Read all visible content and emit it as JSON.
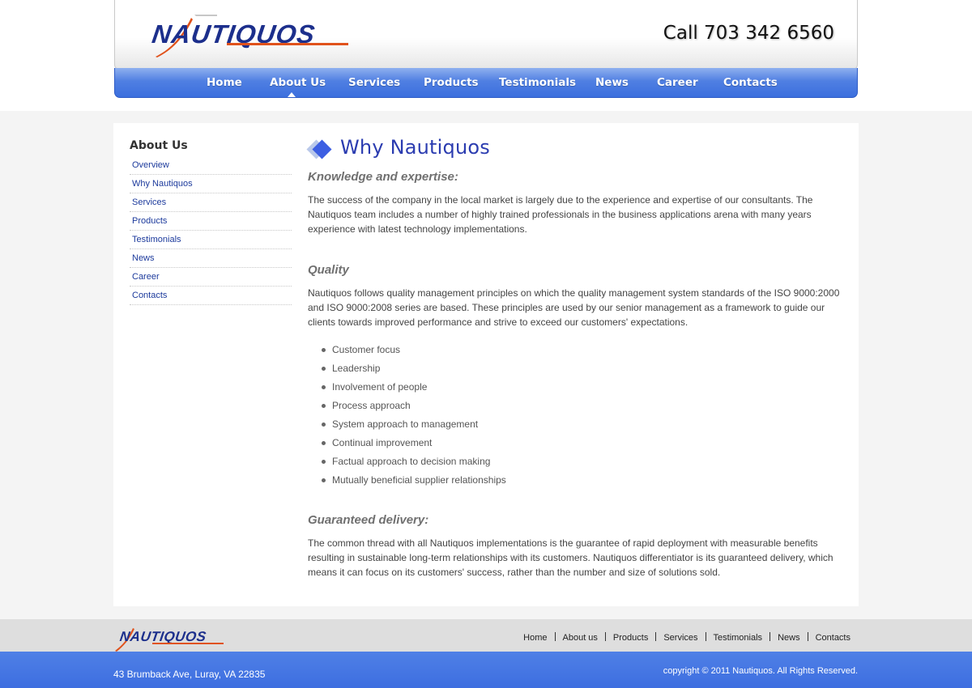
{
  "brand": {
    "logo_text": "NAUTIQUOS",
    "phone": "Call 703 342 6560",
    "colors": {
      "nav_blue": "#4f7fe2",
      "logo_blue": "#1c2f8c",
      "logo_orange": "#e0521b",
      "title_blue": "#2b3cb0"
    }
  },
  "nav": {
    "items": [
      "Home",
      "About Us",
      "Services",
      "Products",
      "Testimonials",
      "News",
      "Career",
      "Contacts"
    ],
    "active": "About Us"
  },
  "sidebar": {
    "title": "About Us",
    "items": [
      "Overview",
      "Why Nautiquos",
      "Services",
      "Products",
      "Testimonials",
      "News",
      "Career",
      "Contacts"
    ]
  },
  "main": {
    "title": "Why Nautiquos",
    "sections": [
      {
        "heading": "Knowledge and expertise:",
        "text": "The success of the company in the local market is largely due to the experience and expertise of our consultants. The Nautiquos team includes a number of highly trained professionals in the business applications arena with many years experience with latest technology implementations."
      },
      {
        "heading": "Quality",
        "text": "Nautiquos follows quality management principles on which the quality management system standards of the ISO 9000:2000 and ISO 9000:2008 series are based. These principles are used by our senior management as a framework to guide our clients towards improved performance and strive to exceed our customers' expectations.",
        "bullets": [
          "Customer focus",
          "Leadership",
          "Involvement of people",
          "Process approach",
          "System approach to management",
          "Continual improvement",
          "Factual approach to decision making",
          "Mutually beneficial supplier relationships"
        ]
      },
      {
        "heading": "Guaranteed delivery:",
        "text": "The common thread with all Nautiquos implementations is the guarantee of rapid deployment with measurable benefits resulting in sustainable long-term relationships with its customers. Nautiquos differentiator is its guaranteed delivery, which means it can focus on its customers' success, rather than the number and size of solutions sold."
      }
    ]
  },
  "footer": {
    "logo_text": "NAUTIQUOS",
    "links": [
      "Home",
      "About us",
      "Products",
      "Services",
      "Testimonials",
      "News",
      "Contacts"
    ],
    "address": "43 Brumback Ave, Luray, VA 22835",
    "copyright": "copyright © 2011 Nautiquos. All Rights Reserved."
  }
}
